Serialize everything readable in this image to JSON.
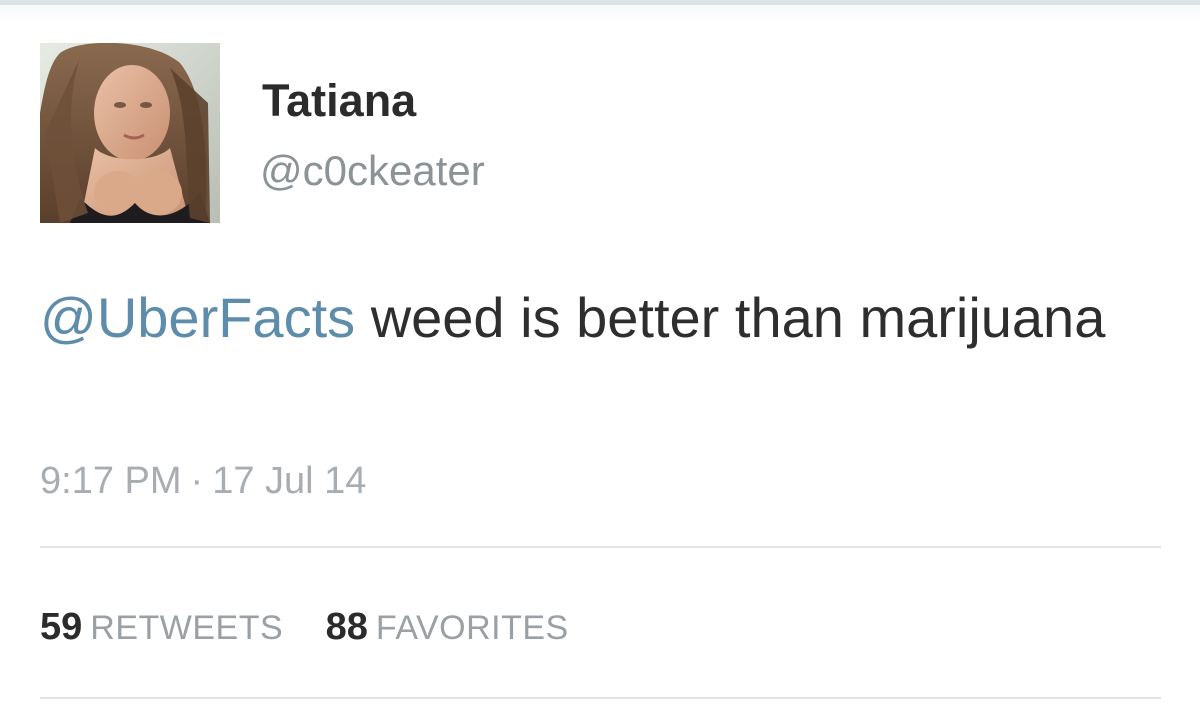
{
  "tweet": {
    "author": {
      "display_name": "Tatiana",
      "handle": "@c0ckeater",
      "avatar_icon": "profile-photo"
    },
    "text": {
      "mention": "@UberFacts",
      "body": " weed is better than marijuana"
    },
    "time": "9:17 PM",
    "separator": "·",
    "date": "17 Jul 14",
    "stats": {
      "retweets_count": "59",
      "retweets_label": "RETWEETS",
      "favorites_count": "88",
      "favorites_label": "FAVORITES"
    }
  },
  "colors": {
    "mention": "#5e8cab",
    "text": "#2e2e2e",
    "muted": "#a8adb1",
    "divider": "#e1e5e8"
  }
}
